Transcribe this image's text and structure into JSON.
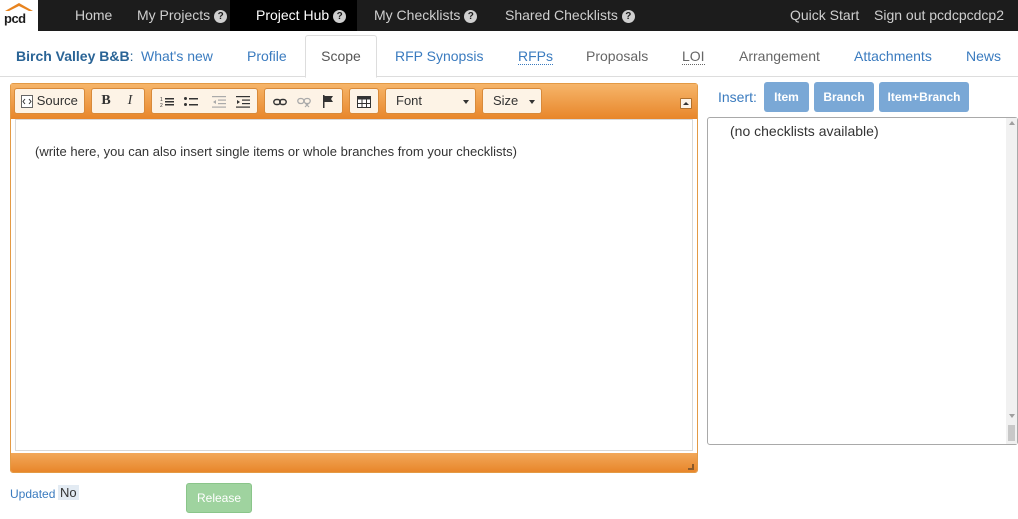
{
  "app": {
    "logo_text": "pcd"
  },
  "nav": {
    "home": "Home",
    "my_projects": "My Projects",
    "project_hub": "Project Hub",
    "my_checklists": "My Checklists",
    "shared_checklists": "Shared Checklists",
    "quick_start": "Quick Start",
    "sign_out": "Sign out pcdcpcdcp2",
    "help_glyph": "?"
  },
  "tabs": {
    "project_name": "Birch Valley B&B",
    "project_colon": ":",
    "whats_new": "What's new",
    "items": [
      {
        "label": "Profile"
      },
      {
        "label": "Scope"
      },
      {
        "label": "RFP Synopsis"
      },
      {
        "label": "RFPs"
      },
      {
        "label": "Proposals"
      },
      {
        "label": "LOI"
      },
      {
        "label": "Arrangement"
      },
      {
        "label": "Attachments"
      },
      {
        "label": "News"
      }
    ],
    "active": "Scope"
  },
  "editor": {
    "toolbar": {
      "source_label": "Source",
      "bold_label": "B",
      "italic_label": "I",
      "font_label": "Font",
      "size_label": "Size",
      "icons": [
        "source-icon",
        "bold-icon",
        "italic-icon",
        "numbered-list-icon",
        "bulleted-list-icon",
        "outdent-icon",
        "indent-icon",
        "link-icon",
        "unlink-icon",
        "anchor-flag-icon",
        "table-icon",
        "collapse-toolbar-icon"
      ]
    },
    "content": "(write here, you can also insert single items or whole branches from your checklists)",
    "colors": {
      "toolbar_accent": "#e8862a"
    }
  },
  "insert": {
    "label": "Insert:",
    "item_button": "Item",
    "branch_button": "Branch",
    "item_branch_button": "Item+Branch",
    "list_placeholder": "(no checklists available)"
  },
  "footer": {
    "updated_label": "Updated",
    "updated_value": "No",
    "release_button": "Release"
  }
}
